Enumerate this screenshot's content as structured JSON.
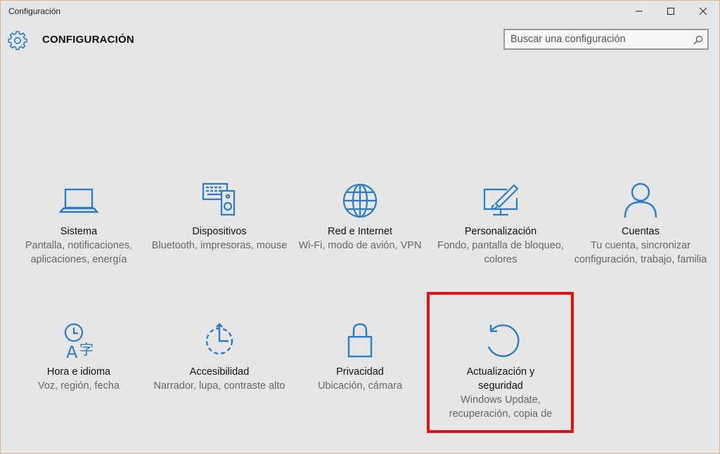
{
  "window": {
    "title": "Configuración"
  },
  "header": {
    "title": "CONFIGURACIÓN"
  },
  "search": {
    "placeholder": "Buscar una configuración"
  },
  "colors": {
    "accent": "#2a7cc7",
    "highlight_border": "#e50f0f"
  },
  "tiles": [
    {
      "icon": "laptop-icon",
      "name": "Sistema",
      "desc": "Pantalla, notificaciones, aplicaciones, energía"
    },
    {
      "icon": "devices-icon",
      "name": "Dispositivos",
      "desc": "Bluetooth, impresoras, mouse"
    },
    {
      "icon": "globe-icon",
      "name": "Red e Internet",
      "desc": "Wi-Fi, modo de avión, VPN"
    },
    {
      "icon": "personalization-icon",
      "name": "Personalización",
      "desc": "Fondo, pantalla de bloqueo, colores"
    },
    {
      "icon": "person-icon",
      "name": "Cuentas",
      "desc": "Tu cuenta, sincronizar configuración, trabajo, familia"
    },
    {
      "icon": "time-language-icon",
      "name": "Hora e idioma",
      "desc": "Voz, región, fecha"
    },
    {
      "icon": "accessibility-icon",
      "name": "Accesibilidad",
      "desc": "Narrador, lupa, contraste alto"
    },
    {
      "icon": "lock-icon",
      "name": "Privacidad",
      "desc": "Ubicación, cámara"
    },
    {
      "icon": "update-icon",
      "name": "Actualización y seguridad",
      "desc": "Windows Update, recuperación, copia de"
    }
  ]
}
